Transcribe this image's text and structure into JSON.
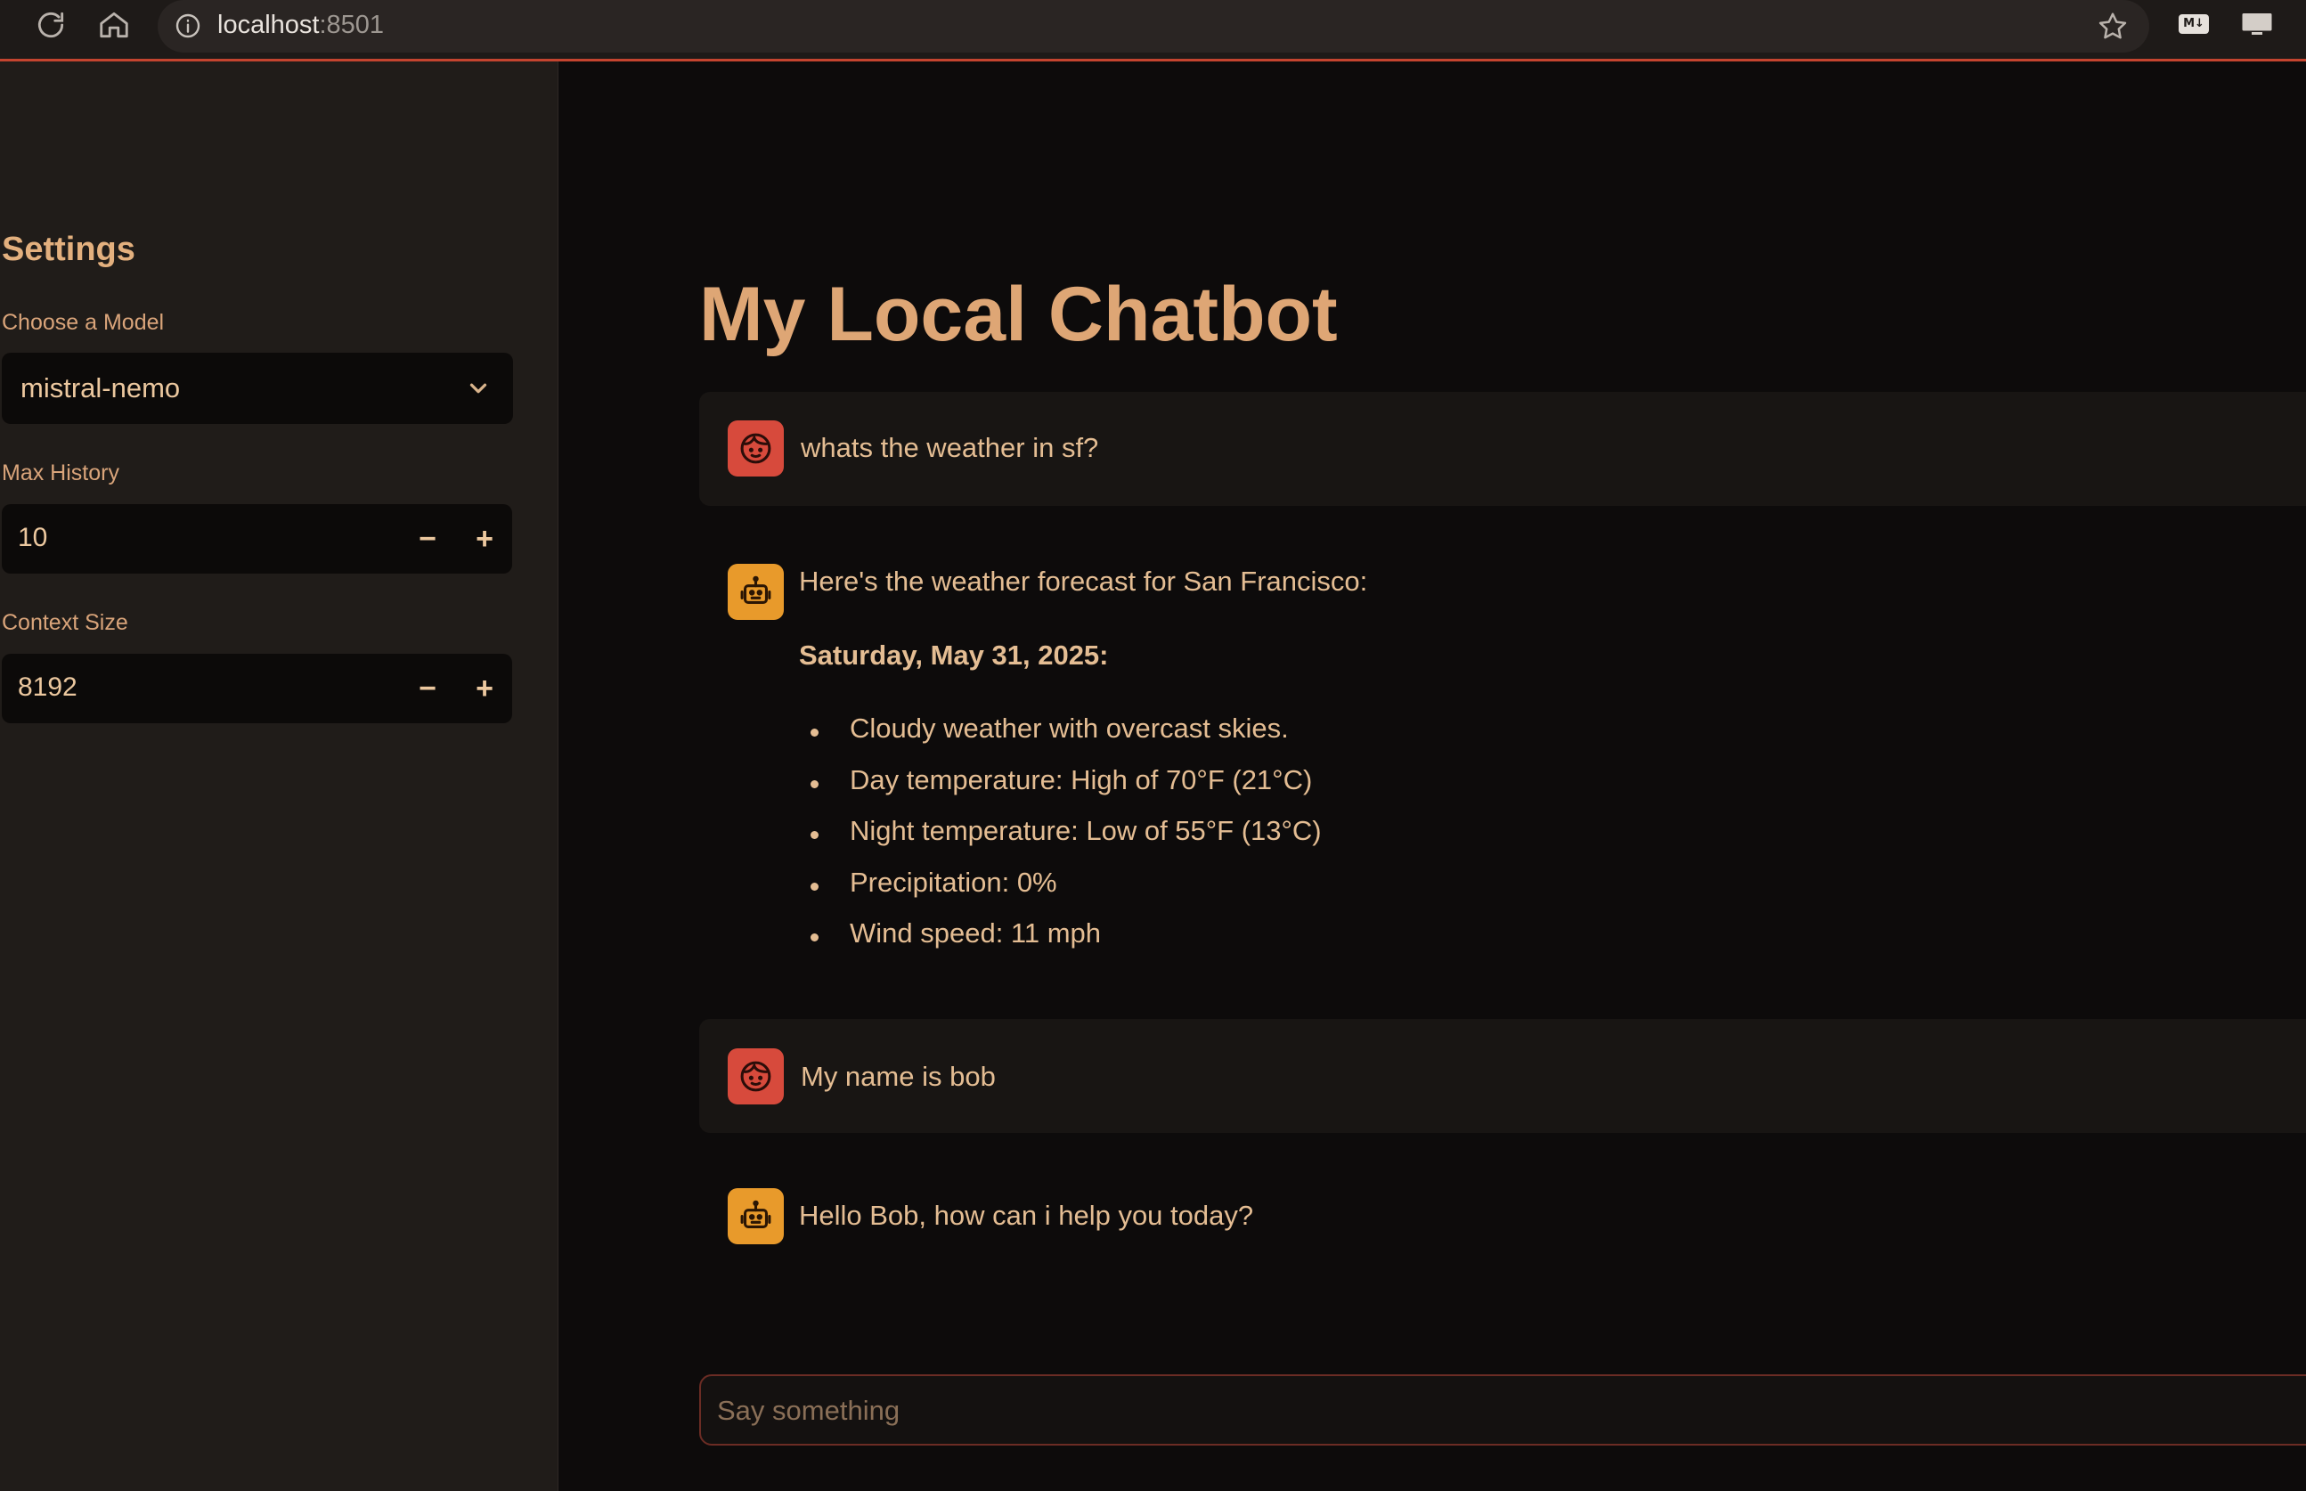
{
  "browser": {
    "url_host": "localhost",
    "url_port": ":8501",
    "extension_md_label": "M↓"
  },
  "sidebar": {
    "title": "Settings",
    "model_label": "Choose a Model",
    "model_value": "mistral-nemo",
    "max_history_label": "Max History",
    "max_history_value": "10",
    "context_size_label": "Context Size",
    "context_size_value": "8192",
    "minus": "−",
    "plus": "+"
  },
  "main": {
    "title": "My Local Chatbot",
    "messages": [
      {
        "role": "user",
        "text": "whats the weather in sf?"
      },
      {
        "role": "assistant",
        "intro": "Here's the weather forecast for San Francisco:",
        "date": "Saturday, May 31, 2025:",
        "bullets": [
          "Cloudy weather with overcast skies.",
          "Day temperature: High of 70°F (21°C)",
          "Night temperature: Low of 55°F (13°C)",
          "Precipitation: 0%",
          "Wind speed: 11 mph"
        ]
      },
      {
        "role": "user",
        "text": "My name is bob"
      },
      {
        "role": "assistant",
        "text": "Hello Bob, how can i help you today?"
      }
    ],
    "input_placeholder": "Say something"
  },
  "colors": {
    "accent": "#dea675",
    "user_avatar": "#d74a3c",
    "bot_avatar": "#e89a2b",
    "sidebar_bg": "#201c19",
    "main_bg": "#0d0b0b"
  }
}
